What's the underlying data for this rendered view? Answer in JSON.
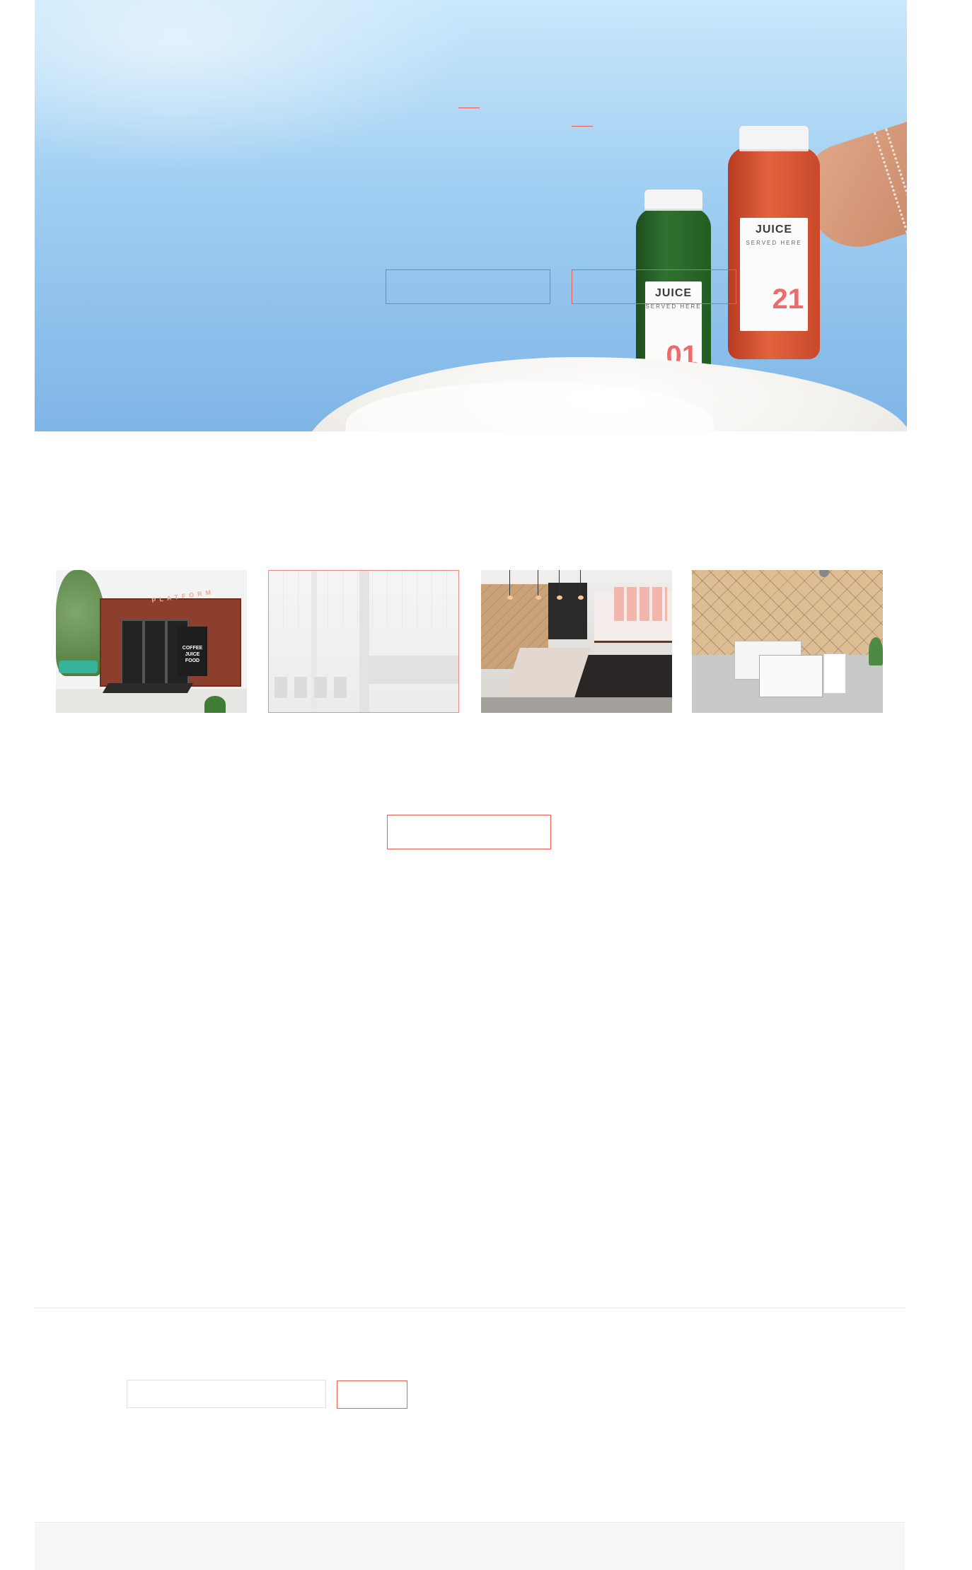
{
  "hero": {
    "bottles": [
      {
        "brand": "JUICE",
        "subtitle": "SERVED HERE",
        "number": "01",
        "color": "#2f7230"
      },
      {
        "brand": "JUICE",
        "subtitle": "SERVED HERE",
        "number": "21",
        "color": "#e3633e"
      }
    ],
    "buttons": [
      {
        "label": ""
      },
      {
        "label": ""
      }
    ]
  },
  "stores": {
    "cards": [
      {
        "sign": "PLATFORM",
        "door_text": "COFFEE JUICE FOOD"
      },
      {},
      {},
      {}
    ],
    "button_label": ""
  },
  "newsletter": {
    "input_placeholder": "",
    "submit_label": ""
  },
  "theme": {
    "accent": "#ef5d50",
    "divider": "#e6e6e6",
    "footer_bg": "#f7f7f7"
  }
}
